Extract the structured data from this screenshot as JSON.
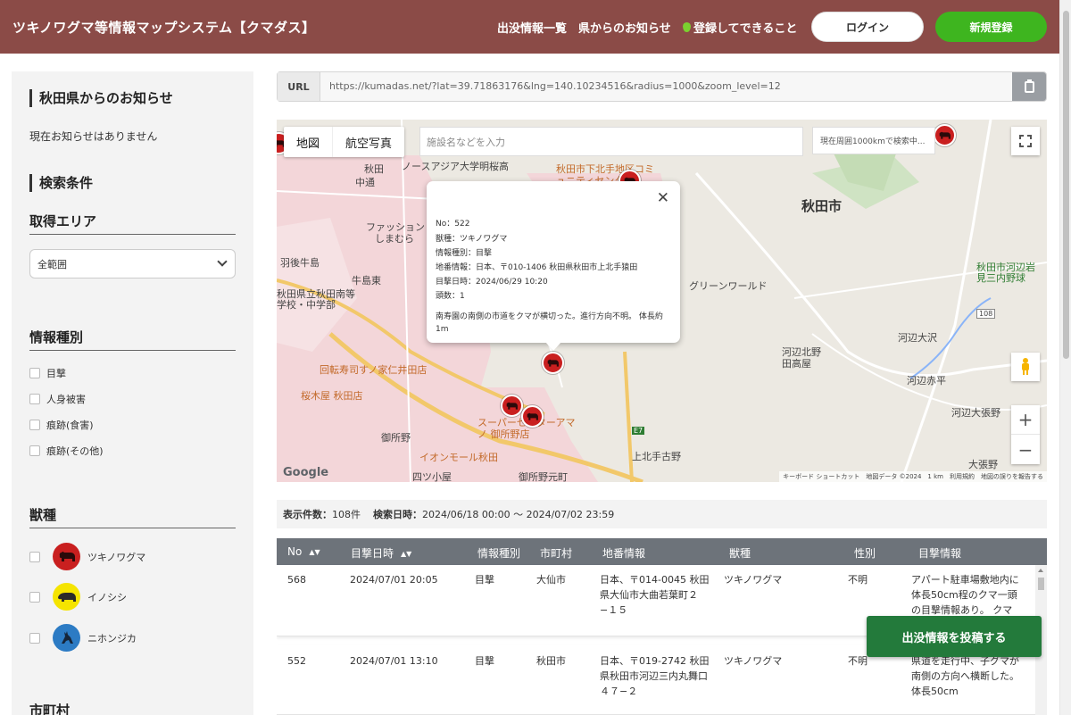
{
  "header": {
    "title": "ツキノワグマ等情報マップシステム【クマダス】",
    "nav": [
      "出没情報一覧",
      "県からのお知らせ",
      "登録してできること"
    ],
    "login": "ログイン",
    "register": "新規登録"
  },
  "sidebar": {
    "notice_title": "秋田県からのお知らせ",
    "notice_text": "現在お知らせはありません",
    "search_title": "検索条件",
    "area_title": "取得エリア",
    "area_value": "全範囲",
    "info_type_title": "情報種別",
    "info_types": [
      "目撃",
      "人身被害",
      "痕跡(食害)",
      "痕跡(その他)"
    ],
    "animal_title": "獣種",
    "animals": [
      {
        "label": "ツキノワグマ",
        "color": "#c91f1f",
        "icon": "bear-icon"
      },
      {
        "label": "イノシシ",
        "color": "#f5e400",
        "icon": "boar-icon"
      },
      {
        "label": "ニホンジカ",
        "color": "#2c7bc4",
        "icon": "deer-icon"
      }
    ],
    "city_title": "市町村"
  },
  "urlbar": {
    "label": "URL",
    "url": "https://kumadas.net/?lat=39.71863176&lng=140.10234516&radius=1000&zoom_level=12"
  },
  "map": {
    "tabs": [
      "地図",
      "航空写真"
    ],
    "search_placeholder": "施設名などを入力",
    "status": "現在周囲1000kmで検索中...",
    "labels": {
      "city": "秋田市",
      "akita": "秋田",
      "nakadori": "中通",
      "university": "ノースアジア大学明桜高",
      "community": "秋田市下北手地区コミュニティセンター",
      "fashion": "ファッション",
      "shimamura": "しまむら",
      "ushijima": "羽後牛島",
      "ushijima_east": "牛島東",
      "school": "秋田県立秋田南等学校・中学部",
      "green_world": "グリーンワールド",
      "kawabe_kitano": "河辺北野田高屋",
      "kawabe_osawa": "河辺大沢",
      "kawabe_akahira": "河辺赤平",
      "kawabe_obari": "河辺大張野",
      "obari": "大張野",
      "kawabe_iwami": "秋田市河辺岩見三内野球",
      "sushi": "回転寿司すノ家仁井田店",
      "sakuragi": "桜木屋 秋田店",
      "super": "スーパーセンターアマノ 御所野店",
      "aeon": "イオンモール秋田",
      "goshono": "御所野",
      "goshono_motomachi": "御所野元町",
      "yotsugoya": "四ツ小屋",
      "kamikita": "上北手古野",
      "route_108": "108",
      "route_e7": "E7"
    },
    "google": "Google",
    "attribution": "キーボード ショートカット　地図データ ©2024　1 km　利用規約　地図の誤りを報告する"
  },
  "popup": {
    "no": "No：522",
    "species": "獣種：ツキノワグマ",
    "info_type": "情報種別：目撃",
    "address": "地番情報：日本、〒010-1406 秋田県秋田市上北手猿田",
    "datetime": "目撃日時：2024/06/29 10:20",
    "count": "頭数：1",
    "description": "南寿園の南側の市道をクマが横切った。進行方向不明。 体長約1m"
  },
  "summary": {
    "count_label": "表示件数：",
    "count_value": "108件",
    "period_label": "検索日時：",
    "period_value": "2024/06/18 00:00 〜 2024/07/02 23:59"
  },
  "table": {
    "headers": [
      "No",
      "目撃日時",
      "情報種別",
      "市町村",
      "地番情報",
      "獣種",
      "性別",
      "目撃情報"
    ],
    "rows": [
      {
        "no": "568",
        "datetime": "2024/07/01 20:05",
        "type": "目撃",
        "city": "大仙市",
        "address": [
          "日本、〒014-0045 秋田",
          "県大仙市大曲若葉町２",
          "−１５"
        ],
        "species": "ツキノワグマ",
        "sex": "不明",
        "info": [
          "アパート駐車場敷地内に",
          "体長50cm程のクマ一頭",
          "の目撃情報あり。 クマ"
        ]
      },
      {
        "no": "552",
        "datetime": "2024/07/01 13:10",
        "type": "目撃",
        "city": "秋田市",
        "address": [
          "日本、〒019-2742 秋田",
          "県秋田市河辺三内丸舞口",
          "４７−２"
        ],
        "species": "ツキノワグマ",
        "sex": "不明",
        "info": [
          "県道を走行中、子グマが",
          "南側の方向へ横断した。",
          "体長50cm"
        ]
      }
    ]
  },
  "post_button": "出没情報を投稿する"
}
